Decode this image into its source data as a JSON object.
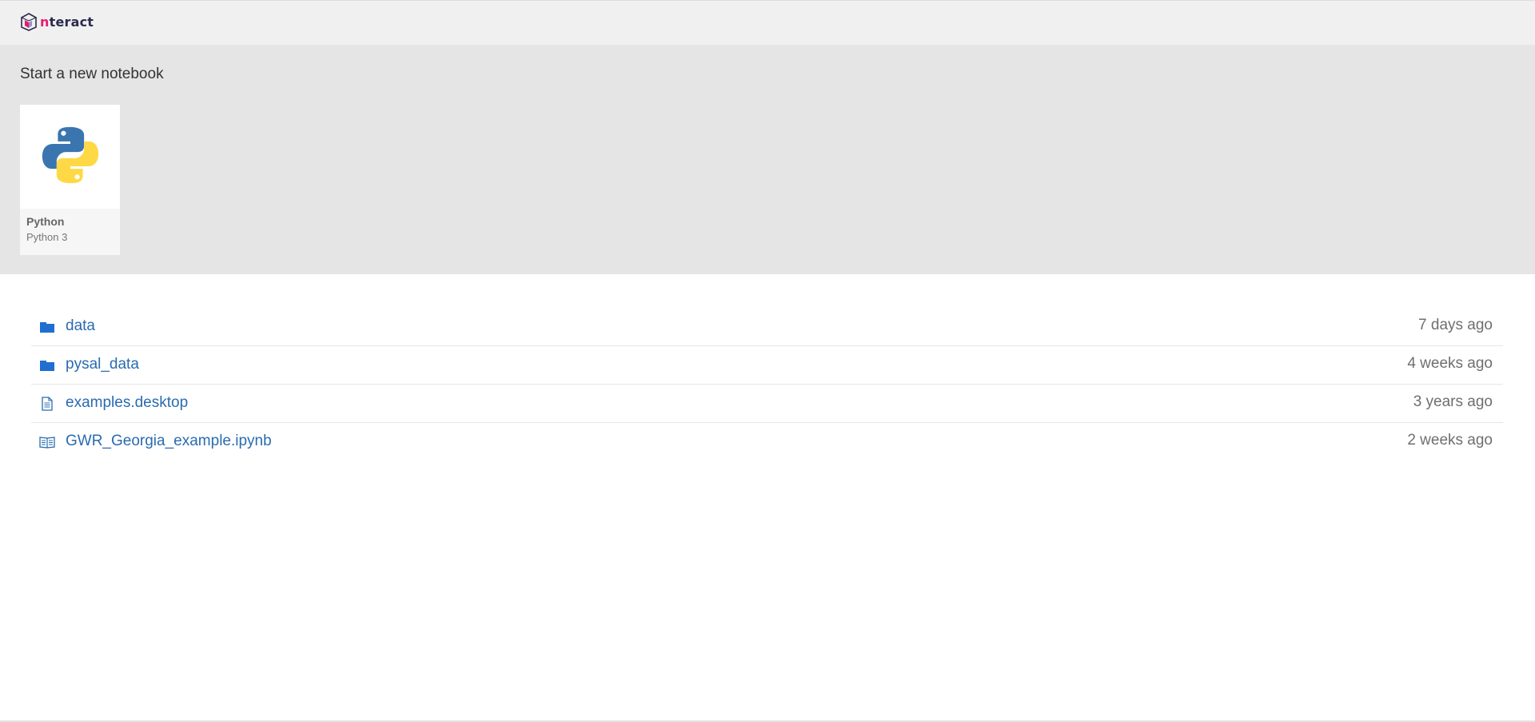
{
  "header": {
    "logo_text_first": "n",
    "logo_text_rest": "teract"
  },
  "new_notebook": {
    "title": "Start a new notebook",
    "kernels": [
      {
        "name": "Python",
        "language": "Python 3",
        "icon": "python-logo-icon"
      }
    ]
  },
  "listing": {
    "items": [
      {
        "type": "directory",
        "icon": "folder-icon",
        "name": "data",
        "modified": "7 days ago"
      },
      {
        "type": "directory",
        "icon": "folder-icon",
        "name": "pysal_data",
        "modified": "4 weeks ago"
      },
      {
        "type": "file",
        "icon": "file-icon",
        "name": "examples.desktop",
        "modified": "3 years ago"
      },
      {
        "type": "notebook",
        "icon": "notebook-icon",
        "name": "GWR_Georgia_example.ipynb",
        "modified": "2 weeks ago"
      }
    ]
  },
  "colors": {
    "link": "#2a6bb0",
    "folder": "#1f6fd1",
    "brand_pink": "#e8196c",
    "brand_dark": "#2b2b4e",
    "python_blue": "#3a75b0",
    "python_yellow": "#ffd845"
  }
}
